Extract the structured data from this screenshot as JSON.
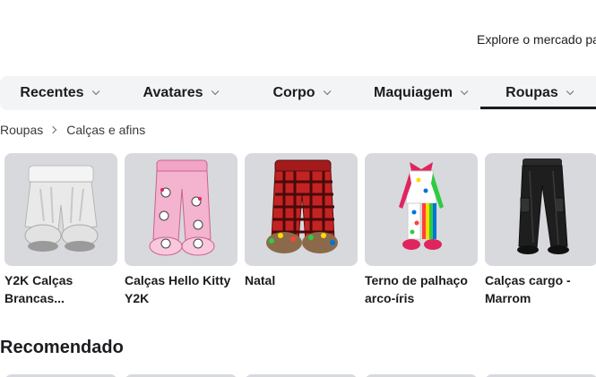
{
  "header": {
    "explore_text": "Explore o mercado pa"
  },
  "tabs": [
    {
      "label": "Recentes"
    },
    {
      "label": "Avatares"
    },
    {
      "label": "Corpo"
    },
    {
      "label": "Maquiagem"
    },
    {
      "label": "Roupas",
      "selected": true
    }
  ],
  "breadcrumb": {
    "parent": "Roupas",
    "current": "Calças e afins"
  },
  "items": [
    {
      "name": "Y2K Calças Brancas..."
    },
    {
      "name": "Calças Hello Kitty Y2K"
    },
    {
      "name": "Natal"
    },
    {
      "name": "Terno de palhaço arco-íris"
    },
    {
      "name": "Calças cargo - Marrom"
    }
  ],
  "recommended": {
    "title": "Recomendado"
  },
  "colors": {
    "tab_bar": "#f3f4f5",
    "thumb_bg": "#d7d9dd",
    "text": "#1b1c1f"
  }
}
